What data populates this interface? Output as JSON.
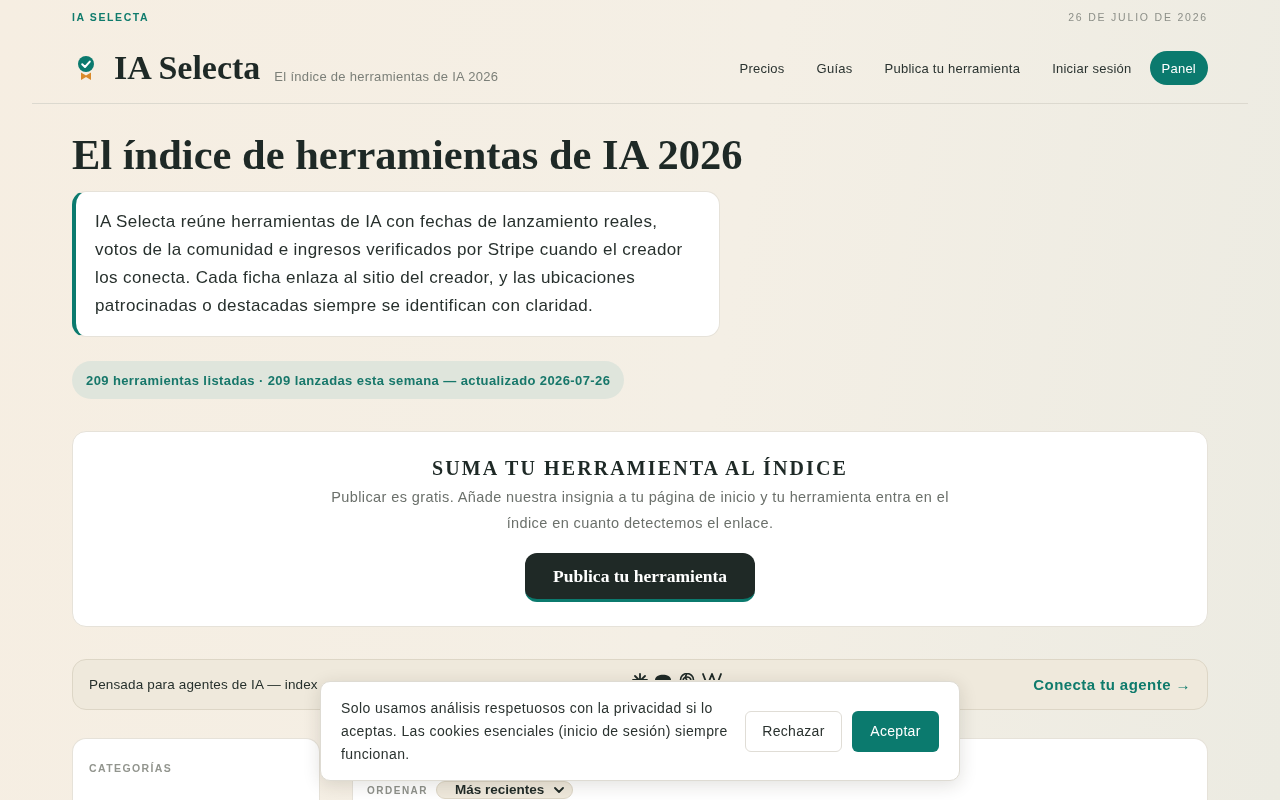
{
  "topbar": {
    "brand": "IA SELECTA",
    "date": "26 DE JULIO DE 2026"
  },
  "header": {
    "logo": "IA Selecta",
    "tagline": "El índice de herramientas de IA 2026",
    "nav": [
      {
        "label": "Precios",
        "kind": "link"
      },
      {
        "label": "Guías",
        "kind": "link"
      },
      {
        "label": "Publica tu herramienta",
        "kind": "link"
      },
      {
        "label": "Iniciar sesión",
        "kind": "link"
      },
      {
        "label": "Panel",
        "kind": "button"
      }
    ]
  },
  "hero": {
    "title": "El índice de herramientas de IA 2026",
    "intro": "IA Selecta reúne herramientas de IA con fechas de lanzamiento reales, votos de la comunidad e ingresos verificados por Stripe cuando el creador los conecta. Cada ficha enlaza al sitio del creador, y las ubicaciones patrocinadas o destacadas siempre se identifican con claridad.",
    "stats": "209 herramientas listadas · 209 lanzadas esta semana — actualizado 2026-07-26"
  },
  "cta": {
    "title": "SUMA TU HERRAMIENTA AL ÍNDICE",
    "description": "Publicar es gratis. Añade nuestra insignia a tu página de inicio y tu herramienta entra en el índice en cuanto detectemos el enlace.",
    "button": "Publica tu herramienta"
  },
  "agent_bar": {
    "text": "Pensada para agentes de IA — index",
    "link": "Conecta tu agente →"
  },
  "sidebar": {
    "heading": "CATEGORÍAS"
  },
  "listing": {
    "sort_label": "ORDENAR",
    "sort_value": "Más recientes"
  },
  "cookie_banner": {
    "text": "Solo usamos análisis respetuosos con la privacidad si lo aceptas. Las cookies esenciales (inicio de sesión) siempre funcionan.",
    "buttons": [
      {
        "label": "Rechazar",
        "kind": "secondary"
      },
      {
        "label": "Aceptar",
        "kind": "primary"
      }
    ]
  }
}
